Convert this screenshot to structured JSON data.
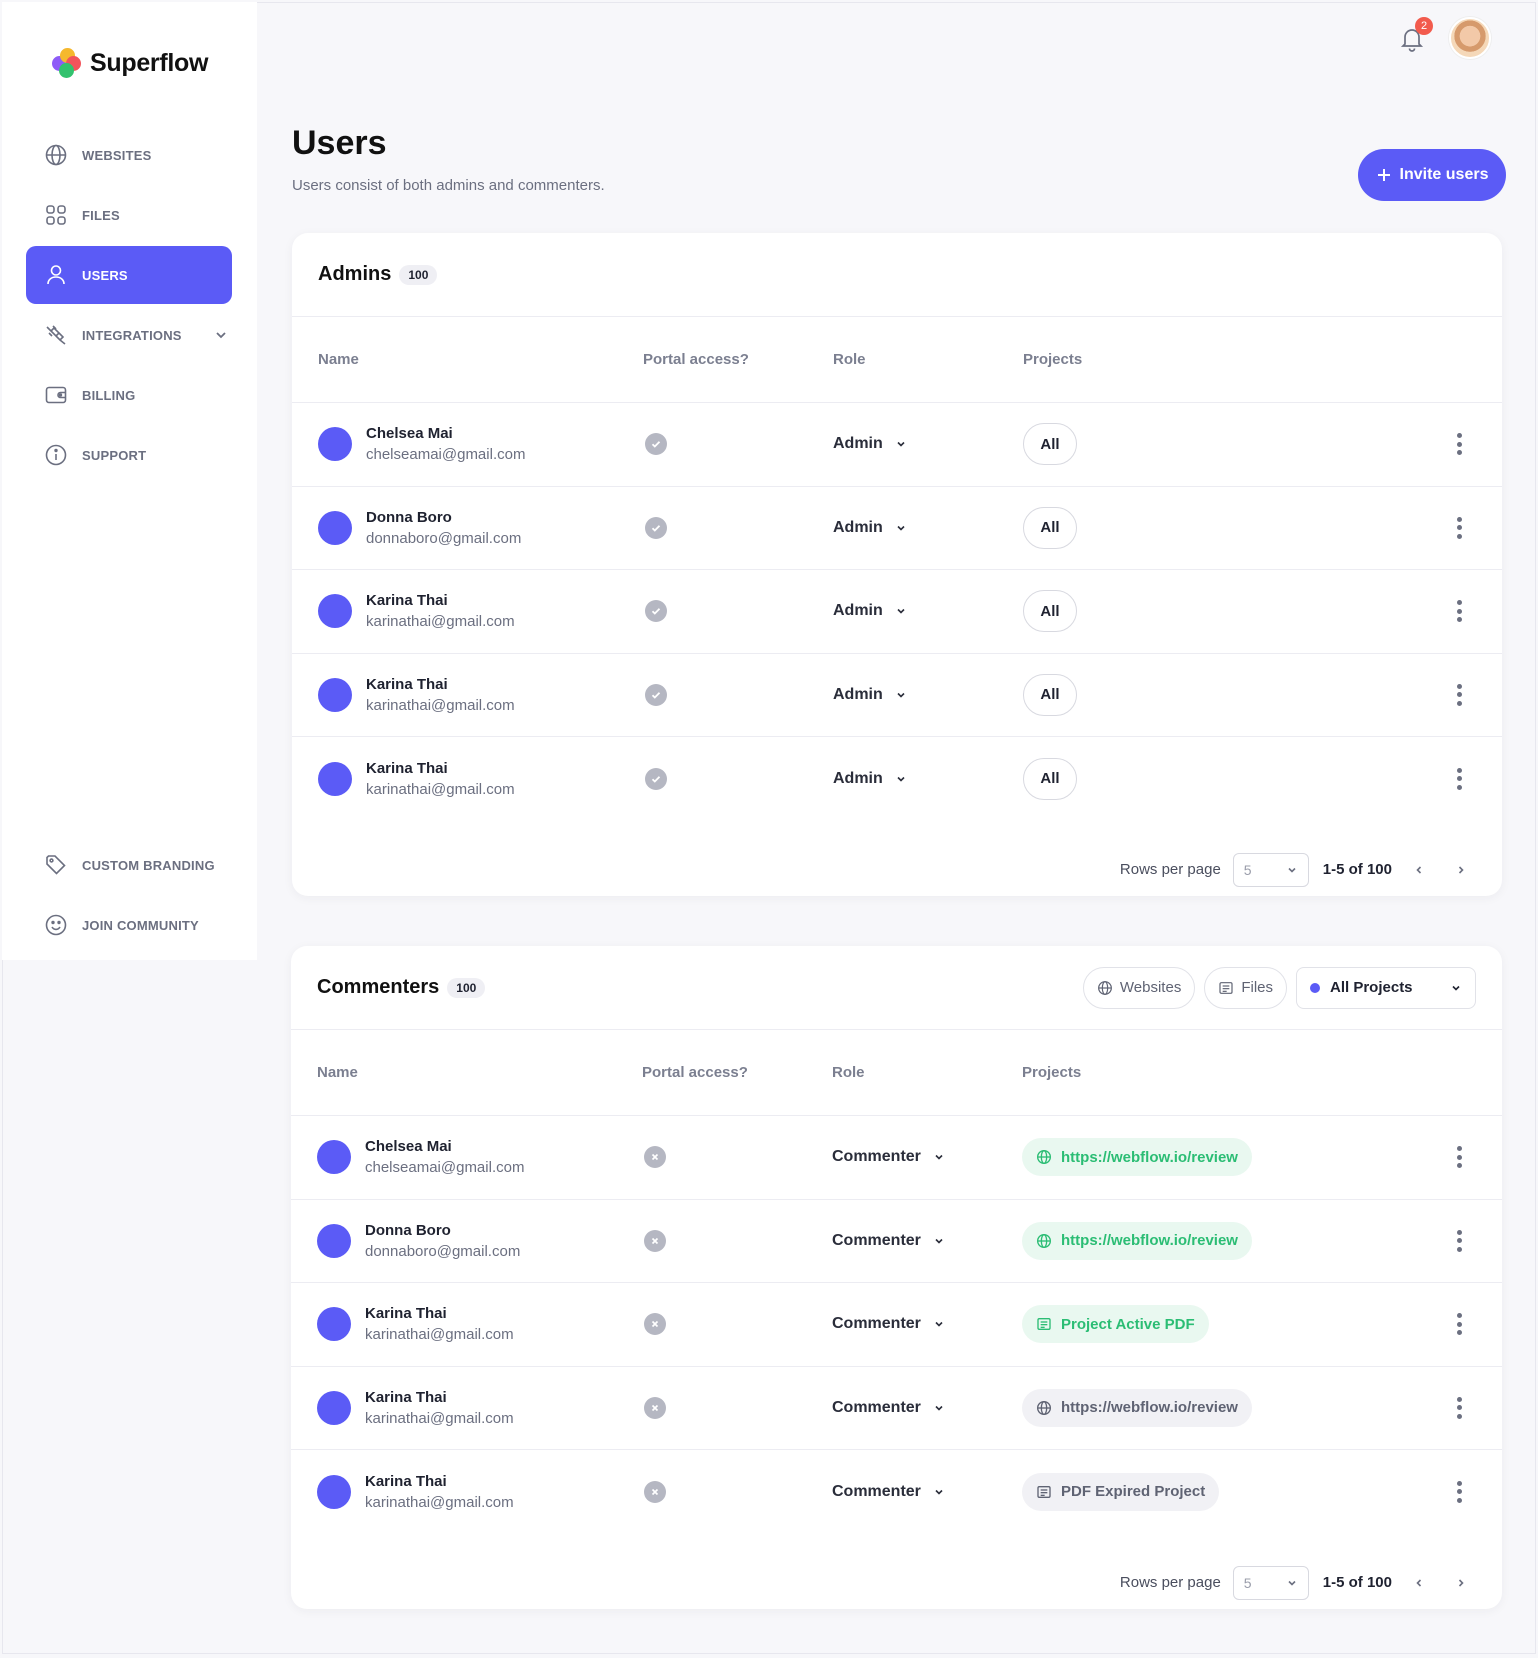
{
  "app": {
    "name": "Superflow",
    "accent": "#5b5bf6",
    "notifications_count": "2"
  },
  "sidebar": {
    "items": [
      {
        "label": "WEBSITES",
        "icon": "globe-icon"
      },
      {
        "label": "FILES",
        "icon": "grid-icon"
      },
      {
        "label": "USERS",
        "icon": "user-icon",
        "active": true
      },
      {
        "label": "INTEGRATIONS",
        "icon": "plug-icon"
      },
      {
        "label": "BILLING",
        "icon": "wallet-icon"
      },
      {
        "label": "SUPPORT",
        "icon": "info-icon"
      }
    ],
    "bottom_items": [
      {
        "label": "CUSTOM BRANDING",
        "icon": "tag-icon"
      },
      {
        "label": "JOIN COMMUNITY",
        "icon": "smile-icon"
      }
    ]
  },
  "header": {
    "title": "Users",
    "subtitle": "Users consist of both admins and commenters.",
    "invite_label": "Invite users"
  },
  "admins": {
    "title": "Admins",
    "count": "100",
    "columns": [
      "Name",
      "Portal access?",
      "Role",
      "Projects"
    ],
    "rows": [
      {
        "name": "Chelsea Mai",
        "email": "chelseamai@gmail.com",
        "role": "Admin",
        "projects": "All"
      },
      {
        "name": "Donna Boro",
        "email": "donnaboro@gmail.com",
        "role": "Admin",
        "projects": "All"
      },
      {
        "name": "Karina Thai",
        "email": "karinathai@gmail.com",
        "role": "Admin",
        "projects": "All"
      },
      {
        "name": "Karina Thai",
        "email": "karinathai@gmail.com",
        "role": "Admin",
        "projects": "All"
      },
      {
        "name": "Karina Thai",
        "email": "karinathai@gmail.com",
        "role": "Admin",
        "projects": "All"
      }
    ],
    "pager": {
      "rows_label": "Rows per page",
      "rows_value": "5",
      "range": "1-5 of 100"
    }
  },
  "commenters": {
    "title": "Commenters",
    "count": "100",
    "filters": {
      "websites": "Websites",
      "files": "Files",
      "projects": "All Projects"
    },
    "columns": [
      "Name",
      "Portal access?",
      "Role",
      "Projects"
    ],
    "rows": [
      {
        "name": "Chelsea Mai",
        "email": "chelseamai@gmail.com",
        "role": "Commenter",
        "project": "https://webflow.io/review",
        "project_type": "web",
        "active": true
      },
      {
        "name": "Donna Boro",
        "email": "donnaboro@gmail.com",
        "role": "Commenter",
        "project": "https://webflow.io/review",
        "project_type": "web",
        "active": true
      },
      {
        "name": "Karina Thai",
        "email": "karinathai@gmail.com",
        "role": "Commenter",
        "project": "Project Active PDF",
        "project_type": "pdf",
        "active": true
      },
      {
        "name": "Karina Thai",
        "email": "karinathai@gmail.com",
        "role": "Commenter",
        "project": "https://webflow.io/review",
        "project_type": "web",
        "active": false
      },
      {
        "name": "Karina Thai",
        "email": "karinathai@gmail.com",
        "role": "Commenter",
        "project": "PDF Expired Project",
        "project_type": "pdf",
        "active": false
      }
    ],
    "pager": {
      "rows_label": "Rows per page",
      "rows_value": "5",
      "range": "1-5 of 100"
    }
  }
}
